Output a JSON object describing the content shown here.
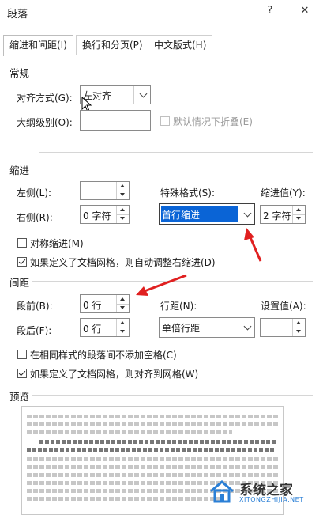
{
  "window": {
    "title": "段落",
    "help": "?",
    "close": "✕"
  },
  "tabs": [
    {
      "label": "缩进和间距(I)",
      "active": true
    },
    {
      "label": "换行和分页(P)",
      "active": false
    },
    {
      "label": "中文版式(H)",
      "active": false
    }
  ],
  "general": {
    "heading": "常规",
    "alignment_label": "对齐方式(G):",
    "alignment_value": "左对齐",
    "outline_label": "大纲级别(O):",
    "outline_value": "",
    "collapse_label": "默认情况下折叠(E)"
  },
  "indent": {
    "heading": "缩进",
    "left_label": "左侧(L):",
    "left_value": "",
    "right_label": "右侧(R):",
    "right_value": "0 字符",
    "special_label": "特殊格式(S):",
    "special_value": "首行缩进",
    "by_label": "缩进值(Y):",
    "by_value": "2 字符",
    "mirror_label": "对称缩进(M)",
    "auto_adjust_label": "如果定义了文档网格，则自动调整右缩进(D)"
  },
  "spacing": {
    "heading": "间距",
    "before_label": "段前(B):",
    "before_value": "0 行",
    "after_label": "段后(F):",
    "after_value": "0 行",
    "line_label": "行距(N):",
    "line_value": "单倍行距",
    "at_label": "设置值(A):",
    "at_value": "",
    "no_space_label": "在相同样式的段落间不添加空格(C)",
    "snap_label": "如果定义了文档网格，则对齐到网格(W)"
  },
  "preview": {
    "heading": "预览"
  },
  "watermark": {
    "text": "系统之家",
    "sub": "XITONGZHIJIA.NET"
  },
  "colors": {
    "highlight": "#0a64d6",
    "arrow": "#e02020"
  }
}
